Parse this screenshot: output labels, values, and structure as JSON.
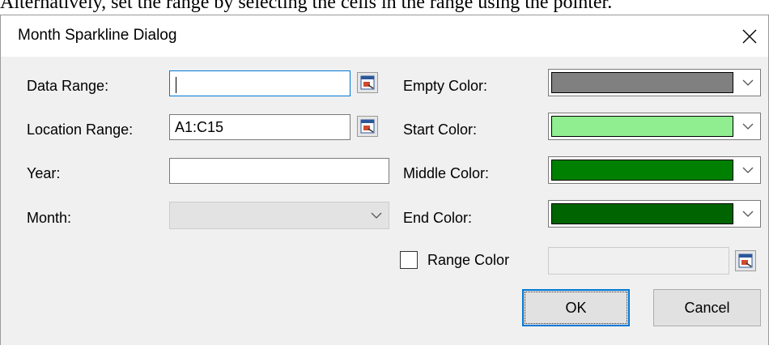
{
  "doc_text": "Alternatively, set the range by selecting the cells in the range using the pointer.",
  "dialog": {
    "title": "Month Sparkline Dialog",
    "close_icon": "close-icon",
    "fields": {
      "data_range": {
        "label": "Data Range:",
        "value": ""
      },
      "location_range": {
        "label": "Location Range:",
        "value": "A1:C15"
      },
      "year": {
        "label": "Year:",
        "value": ""
      },
      "month": {
        "label": "Month:",
        "value": ""
      }
    },
    "colors": {
      "empty": {
        "label": "Empty Color:",
        "value": "#808080"
      },
      "start": {
        "label": "Start Color:",
        "value": "#90ee90"
      },
      "middle": {
        "label": "Middle Color:",
        "value": "#008000"
      },
      "end": {
        "label": "End Color:",
        "value": "#006400"
      }
    },
    "range_color": {
      "label": "Range Color",
      "checked": false,
      "value": ""
    },
    "buttons": {
      "ok": "OK",
      "cancel": "Cancel"
    },
    "range_picker_icon": "range-picker-icon",
    "dropdown_icon": "chevron-down-icon"
  }
}
